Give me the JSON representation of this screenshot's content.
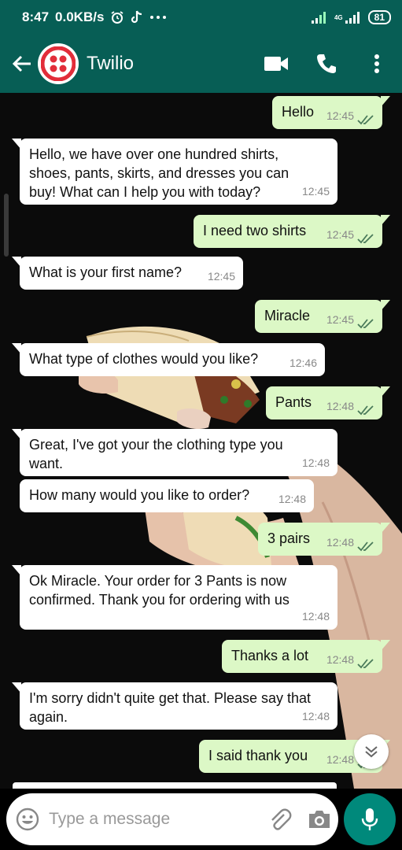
{
  "status_bar": {
    "time": "8:47",
    "speed": "0.0KB/s",
    "network": "4G",
    "battery": "81"
  },
  "header": {
    "contact_name": "Twilio"
  },
  "messages": [
    {
      "text": "Hello",
      "time": "12:45",
      "direction": "out"
    },
    {
      "text": "Hello, we have over one hundred shirts, shoes, pants, skirts, and dresses you can buy! What can I help you with today?",
      "time": "12:45",
      "direction": "in"
    },
    {
      "text": "I need two shirts",
      "time": "12:45",
      "direction": "out"
    },
    {
      "text": "What is your first name?",
      "time": "12:45",
      "direction": "in"
    },
    {
      "text": "Miracle",
      "time": "12:45",
      "direction": "out"
    },
    {
      "text": "What type of clothes would you like?",
      "time": "12:46",
      "direction": "in"
    },
    {
      "text": "Pants",
      "time": "12:48",
      "direction": "out"
    },
    {
      "text": "Great, I've got your the clothing type you want.",
      "time": "12:48",
      "direction": "in"
    },
    {
      "text": "How many would you like to order?",
      "time": "12:48",
      "direction": "in"
    },
    {
      "text": "3 pairs",
      "time": "12:48",
      "direction": "out"
    },
    {
      "text": "Ok Miracle. Your order for 3 Pants is now confirmed. Thank you for ordering with us",
      "time": "12:48",
      "direction": "in"
    },
    {
      "text": "Thanks a lot",
      "time": "12:48",
      "direction": "out"
    },
    {
      "text": "I'm sorry didn't quite get that. Please say that again.",
      "time": "12:48",
      "direction": "in"
    },
    {
      "text": "I said thank you",
      "time": "12:48",
      "direction": "out"
    }
  ],
  "input": {
    "placeholder": "Type a message",
    "value": ""
  },
  "icons": {
    "back": "arrow-left-icon",
    "video": "video-call-icon",
    "call": "phone-icon",
    "menu": "more-vert-icon",
    "emoji": "emoji-icon",
    "attach": "paperclip-icon",
    "camera": "camera-icon",
    "mic": "microphone-icon",
    "scroll_down": "chevron-double-down-icon"
  },
  "colors": {
    "header": "#075e55",
    "outgoing_bubble": "#dcf8c6",
    "incoming_bubble": "#ffffff",
    "mic_button": "#00897b",
    "read_ticks": "#4a7a5a",
    "twilio_red": "#e22d3a"
  }
}
